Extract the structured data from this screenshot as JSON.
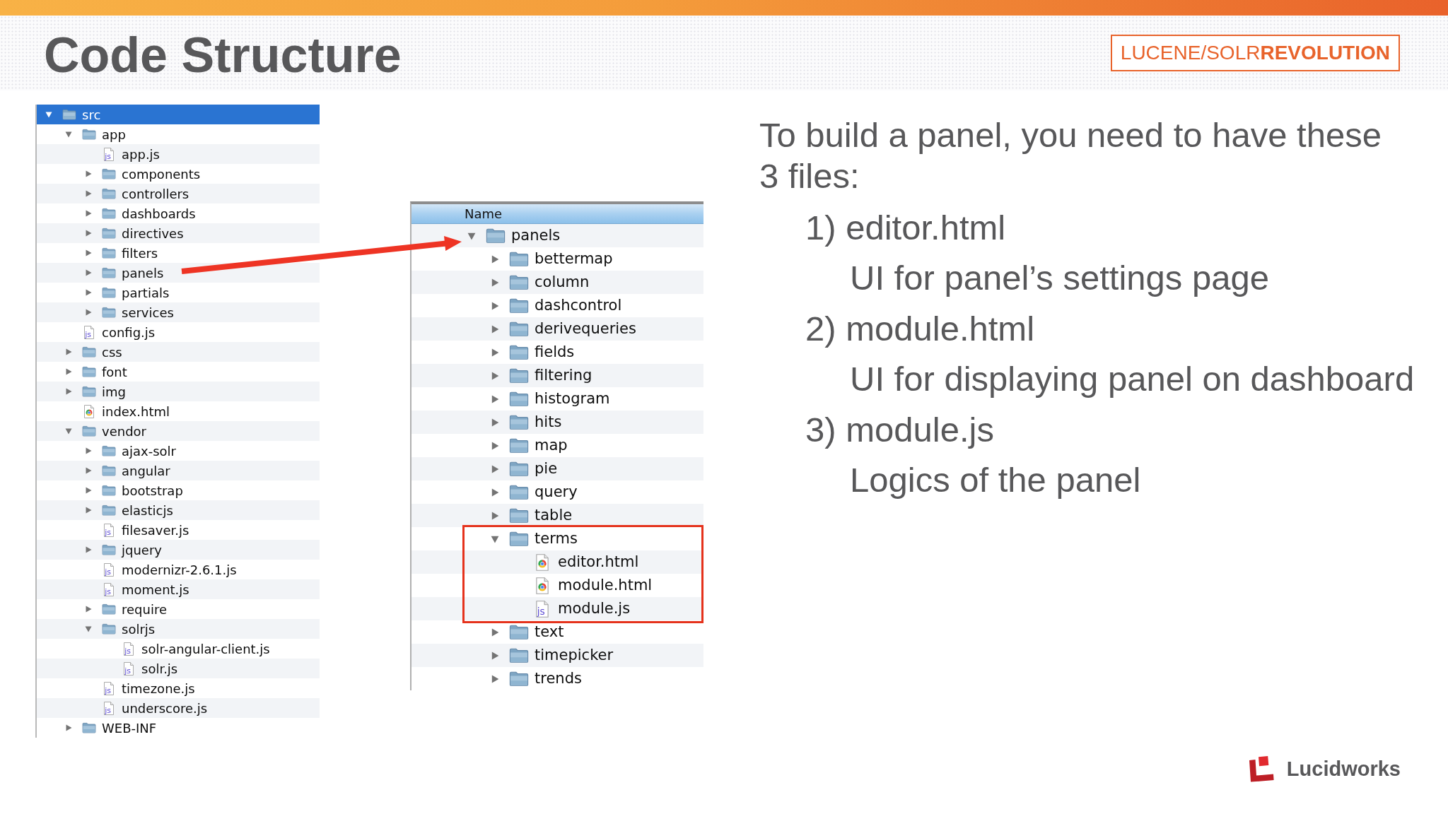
{
  "header": {
    "title": "Code Structure",
    "event_logo": "LUCENE/SOLR**REVOLUTION**"
  },
  "left_tree": {
    "items": [
      {
        "name": "src",
        "kind": "folder",
        "expanded": true,
        "selected": true,
        "children": [
          {
            "name": "app",
            "kind": "folder",
            "expanded": true,
            "selected": false,
            "children": [
              {
                "name": "app.js",
                "kind": "js",
                "icon_text": "js",
                "selected": false
              },
              {
                "name": "components",
                "kind": "folder",
                "expanded": false,
                "selected": false
              },
              {
                "name": "controllers",
                "kind": "folder",
                "expanded": false,
                "selected": false
              },
              {
                "name": "dashboards",
                "kind": "folder",
                "expanded": false,
                "selected": false
              },
              {
                "name": "directives",
                "kind": "folder",
                "expanded": false,
                "selected": false
              },
              {
                "name": "filters",
                "kind": "folder",
                "expanded": false,
                "selected": false
              },
              {
                "name": "panels",
                "kind": "folder",
                "expanded": false,
                "selected": false
              },
              {
                "name": "partials",
                "kind": "folder",
                "expanded": false,
                "selected": false
              },
              {
                "name": "services",
                "kind": "folder",
                "expanded": false,
                "selected": false
              }
            ]
          },
          {
            "name": "config.js",
            "kind": "js",
            "icon_text": "js",
            "selected": false
          },
          {
            "name": "css",
            "kind": "folder",
            "expanded": false,
            "selected": false
          },
          {
            "name": "font",
            "kind": "folder",
            "expanded": false,
            "selected": false
          },
          {
            "name": "img",
            "kind": "folder",
            "expanded": false,
            "selected": false
          },
          {
            "name": "index.html",
            "kind": "html",
            "selected": false
          },
          {
            "name": "vendor",
            "kind": "folder",
            "expanded": true,
            "selected": false,
            "children": [
              {
                "name": "ajax-solr",
                "kind": "folder",
                "expanded": false,
                "selected": false
              },
              {
                "name": "angular",
                "kind": "folder",
                "expanded": false,
                "selected": false
              },
              {
                "name": "bootstrap",
                "kind": "folder",
                "expanded": false,
                "selected": false
              },
              {
                "name": "elasticjs",
                "kind": "folder",
                "expanded": false,
                "selected": false
              },
              {
                "name": "filesaver.js",
                "kind": "js",
                "icon_text": "js",
                "selected": false
              },
              {
                "name": "jquery",
                "kind": "folder",
                "expanded": false,
                "selected": false
              },
              {
                "name": "modernizr-2.6.1.js",
                "kind": "js",
                "icon_text": "js",
                "selected": false
              },
              {
                "name": "moment.js",
                "kind": "js",
                "icon_text": "js",
                "selected": false
              },
              {
                "name": "require",
                "kind": "folder",
                "expanded": false,
                "selected": false
              },
              {
                "name": "solrjs",
                "kind": "folder",
                "expanded": true,
                "selected": false,
                "children": [
                  {
                    "name": "solr-angular-client.js",
                    "kind": "js",
                    "icon_text": "js",
                    "selected": false
                  },
                  {
                    "name": "solr.js",
                    "kind": "js",
                    "icon_text": "js",
                    "selected": false
                  }
                ]
              },
              {
                "name": "timezone.js",
                "kind": "js",
                "icon_text": "js",
                "selected": false
              },
              {
                "name": "underscore.js",
                "kind": "js",
                "icon_text": "js",
                "selected": false
              }
            ]
          },
          {
            "name": "WEB-INF",
            "kind": "folder",
            "expanded": false,
            "selected": false
          }
        ]
      }
    ]
  },
  "middle_tree": {
    "header": "Name",
    "items": [
      {
        "name": "panels",
        "kind": "folder",
        "expanded": true,
        "selected": false,
        "highlighted": false,
        "children": [
          {
            "name": "bettermap",
            "kind": "folder",
            "expanded": false,
            "selected": false,
            "highlighted": false
          },
          {
            "name": "column",
            "kind": "folder",
            "expanded": false,
            "selected": false,
            "highlighted": false
          },
          {
            "name": "dashcontrol",
            "kind": "folder",
            "expanded": false,
            "selected": false,
            "highlighted": false
          },
          {
            "name": "derivequeries",
            "kind": "folder",
            "expanded": false,
            "selected": false,
            "highlighted": false
          },
          {
            "name": "fields",
            "kind": "folder",
            "expanded": false,
            "selected": false,
            "highlighted": false
          },
          {
            "name": "filtering",
            "kind": "folder",
            "expanded": false,
            "selected": false,
            "highlighted": false
          },
          {
            "name": "histogram",
            "kind": "folder",
            "expanded": false,
            "selected": false,
            "highlighted": false
          },
          {
            "name": "hits",
            "kind": "folder",
            "expanded": false,
            "selected": false,
            "highlighted": false
          },
          {
            "name": "map",
            "kind": "folder",
            "expanded": false,
            "selected": false,
            "highlighted": false
          },
          {
            "name": "pie",
            "kind": "folder",
            "expanded": false,
            "selected": false,
            "highlighted": false
          },
          {
            "name": "query",
            "kind": "folder",
            "expanded": false,
            "selected": false,
            "highlighted": false
          },
          {
            "name": "table",
            "kind": "folder",
            "expanded": false,
            "selected": false,
            "highlighted": false
          },
          {
            "name": "terms",
            "kind": "folder",
            "expanded": true,
            "selected": false,
            "highlighted": true,
            "children": [
              {
                "name": "editor.html",
                "kind": "html",
                "selected": false
              },
              {
                "name": "module.html",
                "kind": "html",
                "selected": false
              },
              {
                "name": "module.js",
                "kind": "js",
                "icon_text": "js",
                "selected": false
              }
            ]
          },
          {
            "name": "text",
            "kind": "folder",
            "expanded": false,
            "selected": false,
            "highlighted": false
          },
          {
            "name": "timepicker",
            "kind": "folder",
            "expanded": false,
            "selected": false,
            "highlighted": false
          },
          {
            "name": "trends",
            "kind": "folder",
            "expanded": false,
            "selected": false,
            "highlighted": false
          }
        ]
      }
    ]
  },
  "description": {
    "intro": "To build a panel, you need to have these 3 files:",
    "files": [
      {
        "label": "1) editor.html",
        "detail": "UI for panel’s settings page"
      },
      {
        "label": "2) module.html",
        "detail": "UI for displaying panel on dashboard"
      },
      {
        "label": "3) module.js",
        "detail": "Logics of the panel"
      }
    ]
  },
  "footer": {
    "brand": "Lucidworks"
  }
}
